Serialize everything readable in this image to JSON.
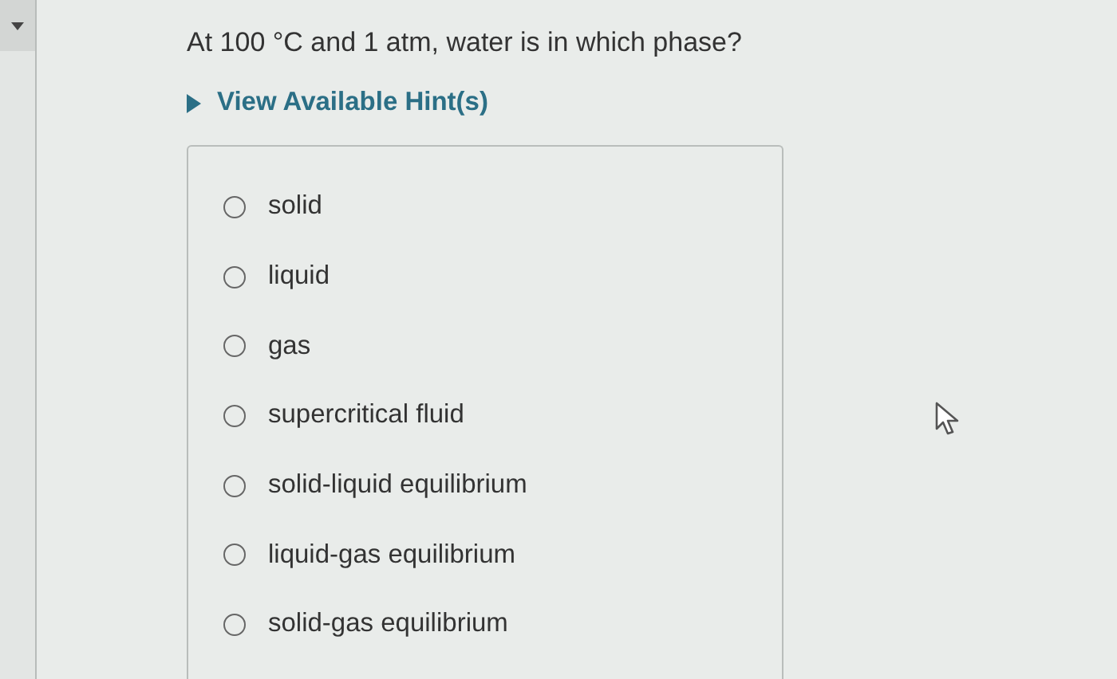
{
  "question": "At 100 °C and 1 atm, water is in which phase?",
  "hint_toggle": {
    "label": "View Available Hint(s)",
    "expanded": false
  },
  "options": [
    {
      "label": "solid",
      "selected": false
    },
    {
      "label": "liquid",
      "selected": false
    },
    {
      "label": "gas",
      "selected": false
    },
    {
      "label": "supercritical fluid",
      "selected": false
    },
    {
      "label": "solid-liquid equilibrium",
      "selected": false
    },
    {
      "label": "liquid-gas equilibrium",
      "selected": false
    },
    {
      "label": "solid-gas equilibrium",
      "selected": false
    }
  ]
}
